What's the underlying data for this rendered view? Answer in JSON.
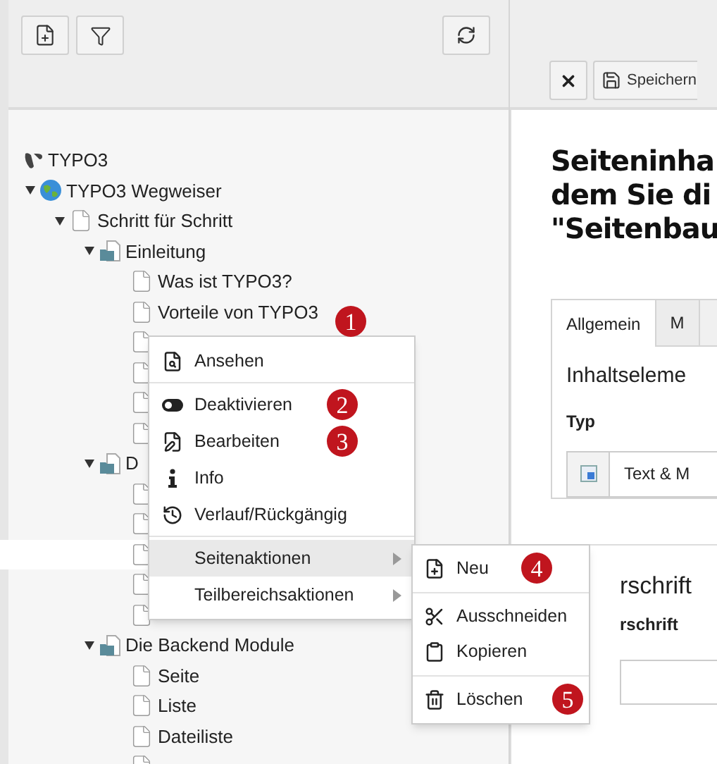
{
  "tree": {
    "label": "TYPO3",
    "kind": "root",
    "selected": false,
    "children": [
      {
        "label": "TYPO3 Wegweiser",
        "kind": "site",
        "expanded": true,
        "selected": false,
        "children": [
          {
            "label": "Schritt für Schritt",
            "kind": "page",
            "expanded": true,
            "selected": false,
            "children": [
              {
                "label": "Einleitung",
                "kind": "folder",
                "expanded": true,
                "selected": false,
                "children": [
                  {
                    "label": "Was ist TYPO3?",
                    "kind": "page",
                    "selected": false
                  },
                  {
                    "label": "Vorteile von TYPO3",
                    "kind": "page",
                    "selected": false
                  },
                  {
                    "kind": "page",
                    "selected": false
                  },
                  {
                    "kind": "page",
                    "selected": false
                  },
                  {
                    "kind": "page",
                    "selected": false
                  },
                  {
                    "kind": "page",
                    "selected": false
                  }
                ]
              },
              {
                "label": "D",
                "kind": "folder",
                "expanded": true,
                "selected": false,
                "children": [
                  {
                    "kind": "page",
                    "selected": false
                  },
                  {
                    "kind": "page",
                    "selected": false
                  },
                  {
                    "kind": "page",
                    "selected": true
                  },
                  {
                    "kind": "page",
                    "selected": false
                  },
                  {
                    "kind": "page",
                    "selected": false
                  }
                ]
              },
              {
                "label": "Die Backend Module",
                "kind": "folder",
                "expanded": true,
                "selected": false,
                "children": [
                  {
                    "label": "Seite",
                    "kind": "page",
                    "selected": false
                  },
                  {
                    "label": "Liste",
                    "kind": "page",
                    "selected": false
                  },
                  {
                    "label": "Dateiliste",
                    "kind": "page",
                    "selected": false
                  },
                  {
                    "kind": "page",
                    "selected": false
                  }
                ]
              }
            ]
          }
        ]
      }
    ]
  },
  "context_menu": {
    "badge": "1",
    "groups": [
      [
        {
          "label": "Ansehen",
          "kind": "view",
          "selected": false
        }
      ],
      [
        {
          "label": "Deaktivieren",
          "kind": "toggle",
          "selected": false,
          "badge": "2"
        },
        {
          "label": "Bearbeiten",
          "kind": "edit",
          "selected": false,
          "badge": "3"
        },
        {
          "label": "Info",
          "kind": "info",
          "selected": false
        },
        {
          "label": "Verlauf/Rückgängig",
          "kind": "history",
          "selected": false
        }
      ],
      [
        {
          "label": "Seitenaktionen",
          "kind": "submenu",
          "selected": true
        },
        {
          "label": "Teilbereichsaktionen",
          "kind": "submenu",
          "selected": false
        }
      ]
    ]
  },
  "submenu": {
    "groups": [
      [
        {
          "label": "Neu",
          "kind": "new",
          "badge": "4"
        }
      ],
      [
        {
          "label": "Ausschneiden",
          "kind": "cut"
        },
        {
          "label": "Kopieren",
          "kind": "copy"
        }
      ],
      [
        {
          "label": "Löschen",
          "kind": "delete",
          "badge": "5"
        }
      ]
    ]
  },
  "toolbar": {
    "save_label": "Speichern"
  },
  "content": {
    "heading_lines": [
      "Seiteninha",
      "dem Sie di",
      "\"Seitenbau"
    ],
    "tabs": [
      {
        "label": "Allgemein",
        "selected": true
      },
      {
        "label": "M",
        "selected": false
      }
    ],
    "section_title": "Inhaltseleme",
    "type_label": "Typ",
    "type_value": "Text & M",
    "header_title": "rschrift",
    "header_label": "rschrift"
  }
}
